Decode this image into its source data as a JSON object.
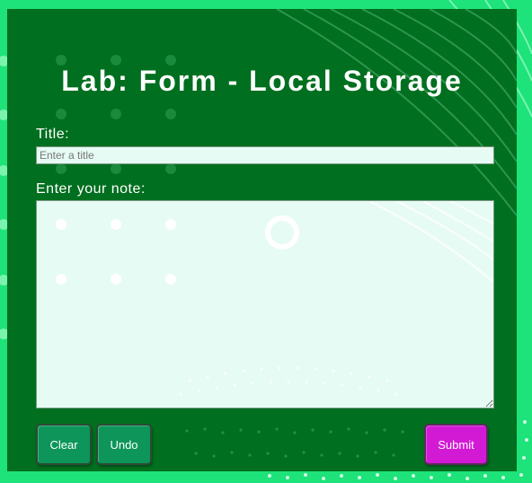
{
  "page": {
    "title": "Lab: Form - Local Storage"
  },
  "form": {
    "title_label": "Title:",
    "title_placeholder": "Enter a title",
    "title_value": "",
    "note_label": "Enter your note:",
    "note_value": ""
  },
  "buttons": {
    "clear_label": "Clear",
    "undo_label": "Undo",
    "submit_label": "Submit"
  },
  "colors": {
    "background": "#1ee27a",
    "panel": "#006f1f",
    "input_background": "#e6fbf3",
    "button_green": "#0d955a",
    "button_submit": "#d21ad4"
  }
}
